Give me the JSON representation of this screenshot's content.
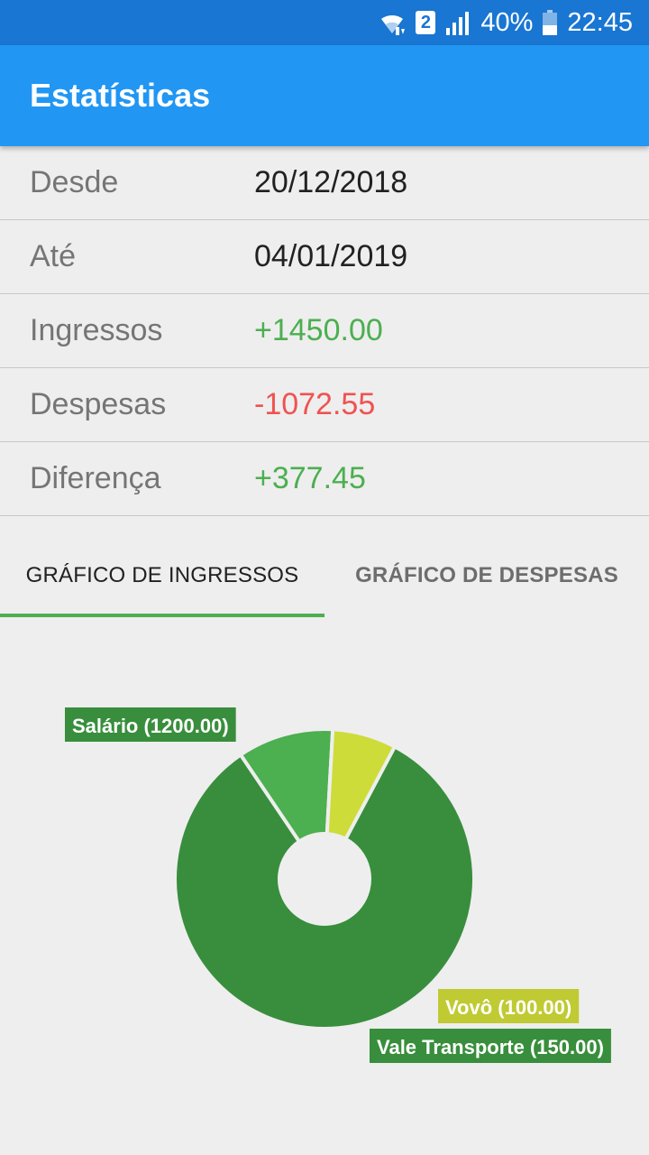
{
  "status_bar": {
    "battery": "40%",
    "time": "22:45",
    "sim": "2",
    "icons": [
      "wifi-icon",
      "sim-2-icon",
      "signal-icon",
      "battery-icon"
    ]
  },
  "app_bar": {
    "title": "Estatísticas",
    "color": "#2196f3"
  },
  "stats": [
    {
      "label": "Desde",
      "value": "20/12/2018",
      "tone": "normal"
    },
    {
      "label": "Até",
      "value": "04/01/2019",
      "tone": "normal"
    },
    {
      "label": "Ingressos",
      "value": "+1450.00",
      "tone": "pos"
    },
    {
      "label": "Despesas",
      "value": "-1072.55",
      "tone": "neg"
    },
    {
      "label": "Diferença",
      "value": "+377.45",
      "tone": "pos"
    }
  ],
  "tabs": [
    {
      "label": "GRÁFICO DE INGRESSOS",
      "active": true
    },
    {
      "label": "GRÁFICO DE DESPESAS",
      "active": false
    }
  ],
  "chart_data": {
    "type": "pie",
    "title": "",
    "categories": [
      "Salário",
      "Vale Transporte",
      "Vovô"
    ],
    "values": [
      1200.0,
      150.0,
      100.0
    ],
    "labels": [
      "Salário (1200.00)",
      "Vale Transporte (150.00)",
      "Vovô (100.00)"
    ],
    "colors": [
      "#388e3c",
      "#4caf50",
      "#cddc39"
    ],
    "label_colors": [
      "#388e3c",
      "#388e3c",
      "#c0ca33"
    ],
    "donut": true
  }
}
